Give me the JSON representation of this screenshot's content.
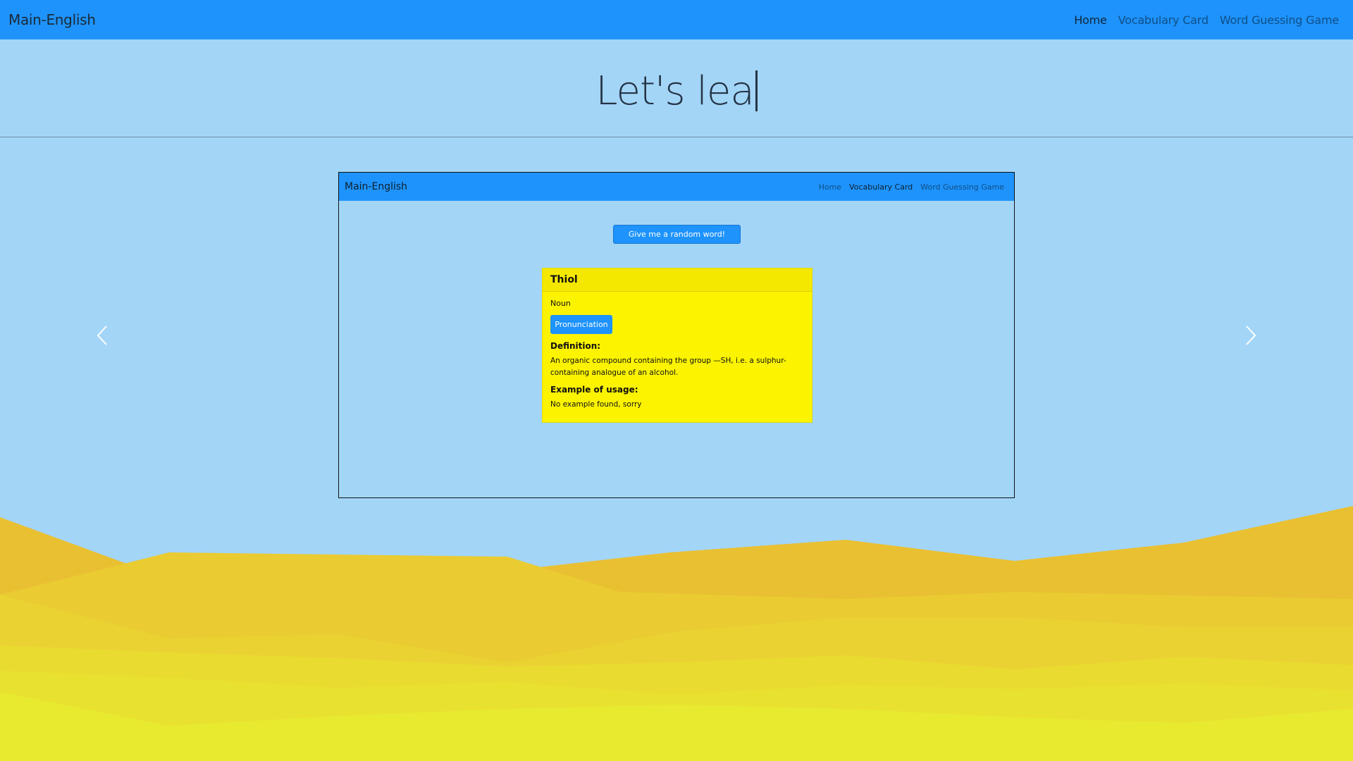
{
  "nav": {
    "brand": "Main-English",
    "links": [
      "Home",
      "Vocabulary Card",
      "Word Guessing Game"
    ],
    "active_index": 0
  },
  "hero": {
    "typed_text": "Let's lea"
  },
  "carousel": {
    "prev_icon": "chevron-left-icon",
    "next_icon": "chevron-right-icon",
    "slide": {
      "nav": {
        "brand": "Main-English",
        "links": [
          "Home",
          "Vocabulary Card",
          "Word Guessing Game"
        ],
        "active_index": 1
      },
      "random_button": "Give me a random word!",
      "card": {
        "word": "Thiol",
        "part_of_speech": "Noun",
        "pronunciation_button": "Pronunciation",
        "definition_title": "Definition:",
        "definition_text": "An organic compound containing the group —SH, i.e. a sulphur-containing analogue of an alcohol.",
        "example_title": "Example of usage:",
        "example_text": "No example found, sorry"
      }
    }
  },
  "colors": {
    "navbar": "#1e93fb",
    "background": "#a3d5f7",
    "card": "#fbf300"
  }
}
